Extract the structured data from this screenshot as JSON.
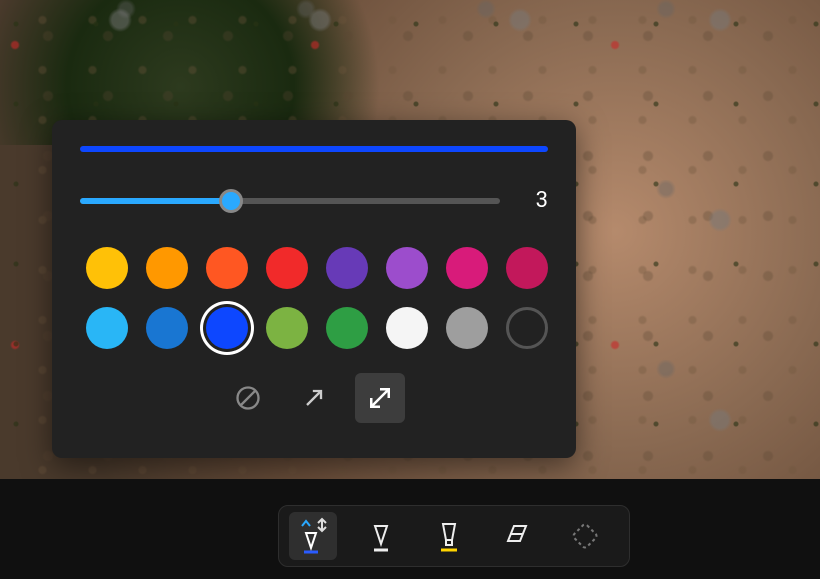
{
  "slider": {
    "value": "3",
    "percent": 36
  },
  "preview_color": "#0d47ff",
  "slider_accent": "#2aa9ff",
  "colors_row1": [
    {
      "name": "yellow",
      "hex": "#ffc107"
    },
    {
      "name": "amber",
      "hex": "#ff9800"
    },
    {
      "name": "orange",
      "hex": "#ff5722"
    },
    {
      "name": "red",
      "hex": "#f12a2a"
    },
    {
      "name": "purple",
      "hex": "#673ab7"
    },
    {
      "name": "violet",
      "hex": "#9c4dcc"
    },
    {
      "name": "magenta",
      "hex": "#d81b7a"
    },
    {
      "name": "crimson",
      "hex": "#c2185b"
    }
  ],
  "colors_row2": [
    {
      "name": "sky",
      "hex": "#29b6f6"
    },
    {
      "name": "azure",
      "hex": "#1976d2"
    },
    {
      "name": "blue",
      "hex": "#0d47ff",
      "selected": true
    },
    {
      "name": "lime",
      "hex": "#7cb342"
    },
    {
      "name": "green",
      "hex": "#2e9e44"
    },
    {
      "name": "white",
      "hex": "#f5f5f5"
    },
    {
      "name": "gray",
      "hex": "#9e9e9e"
    },
    {
      "name": "none",
      "hex": "",
      "hollow": true
    }
  ],
  "arrow_styles": [
    {
      "id": "none",
      "selected": false
    },
    {
      "id": "one-way",
      "selected": false
    },
    {
      "id": "two-way",
      "selected": true
    }
  ],
  "toolbar": {
    "tools": [
      {
        "id": "pen-blue",
        "selected": true
      },
      {
        "id": "pen",
        "selected": false
      },
      {
        "id": "highlighter",
        "selected": false
      },
      {
        "id": "eraser",
        "selected": false
      },
      {
        "id": "shape",
        "selected": false
      }
    ]
  }
}
